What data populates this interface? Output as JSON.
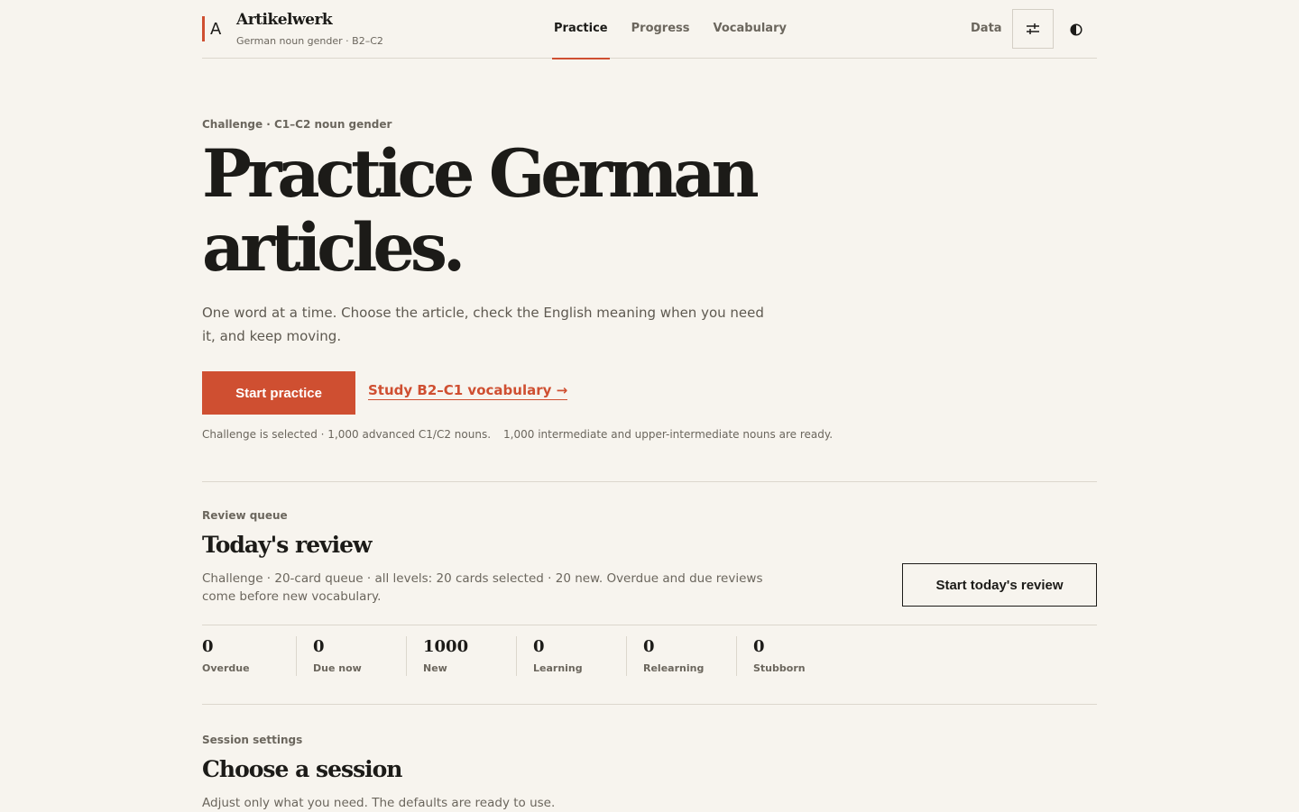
{
  "header": {
    "brand_letter": "A",
    "brand_name": "Artikelwerk",
    "brand_subtitle": "German noun gender · B2–C2",
    "nav": [
      {
        "label": "Practice",
        "active": true
      },
      {
        "label": "Progress",
        "active": false
      },
      {
        "label": "Vocabulary",
        "active": false
      }
    ],
    "data_label": "Data",
    "settings_icon": "sliders-icon",
    "theme_icon": "half-circle-icon"
  },
  "hero": {
    "kicker": "Challenge · C1–C2 noun gender",
    "title_line1": "Practice German",
    "title_line2": "articles.",
    "lede": "One word at a time. Choose the article, check the English meaning when you need it, and keep moving.",
    "primary_cta": "Start practice",
    "secondary_cta": "Study B2–C1 vocabulary →",
    "note_1": "Challenge is selected · 1,000 advanced C1/C2 nouns.",
    "note_2": "1,000 intermediate and upper-intermediate nouns are ready."
  },
  "review": {
    "kicker": "Review queue",
    "title": "Today's review",
    "description": "Challenge · 20-card queue · all levels: 20 cards selected · 20 new. Overdue and due reviews come before new vocabulary.",
    "cta": "Start today's review",
    "stats": [
      {
        "value": "0",
        "label": "Overdue"
      },
      {
        "value": "0",
        "label": "Due now"
      },
      {
        "value": "1000",
        "label": "New"
      },
      {
        "value": "0",
        "label": "Learning"
      },
      {
        "value": "0",
        "label": "Relearning"
      },
      {
        "value": "0",
        "label": "Stubborn"
      }
    ]
  },
  "session": {
    "kicker": "Session settings",
    "title": "Choose a session",
    "description": "Adjust only what you need. The defaults are ready to use."
  },
  "colors": {
    "accent": "#cf4f31",
    "background": "#f7f4ee",
    "text": "#1c1b18",
    "muted": "#6b665d"
  }
}
